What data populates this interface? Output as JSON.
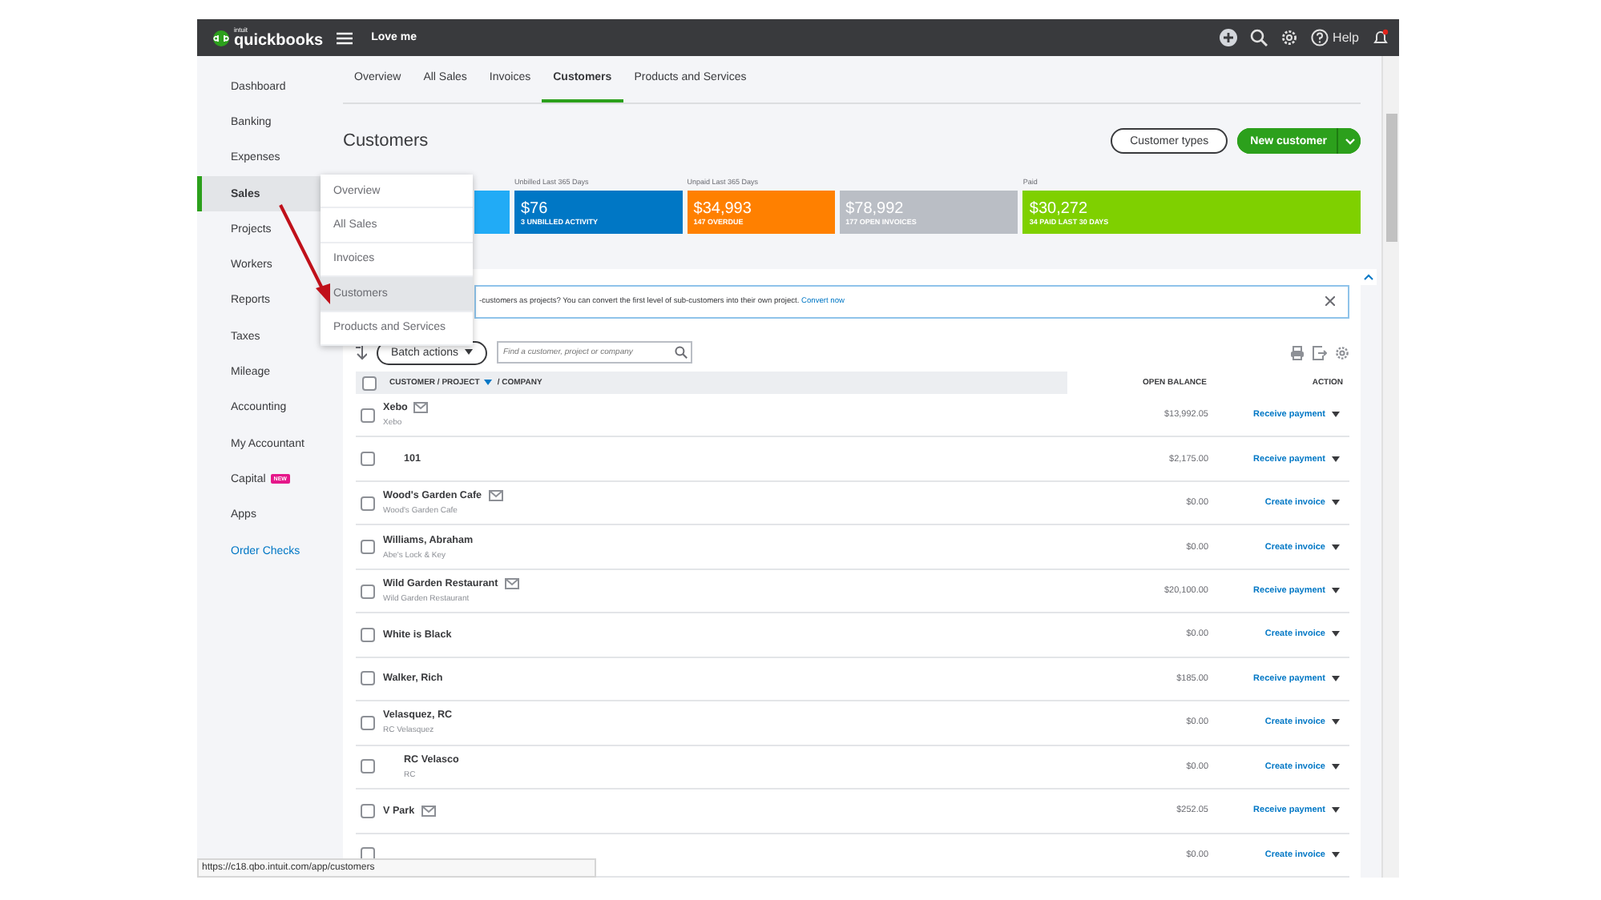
{
  "top_bar": {
    "logo_small": "intuit",
    "logo": "quickbooks",
    "company": "Love me",
    "help": "Help"
  },
  "sidebar": {
    "items": [
      {
        "label": "Dashboard",
        "selected": false,
        "kind": "nav"
      },
      {
        "label": "Banking",
        "selected": false,
        "kind": "nav"
      },
      {
        "label": "Expenses",
        "selected": false,
        "kind": "nav"
      },
      {
        "label": "Sales",
        "selected": true,
        "kind": "nav"
      },
      {
        "label": "Projects",
        "selected": false,
        "kind": "nav"
      },
      {
        "label": "Workers",
        "selected": false,
        "kind": "nav"
      },
      {
        "label": "Reports",
        "selected": false,
        "kind": "nav"
      },
      {
        "label": "Taxes",
        "selected": false,
        "kind": "nav"
      },
      {
        "label": "Mileage",
        "selected": false,
        "kind": "nav"
      },
      {
        "label": "Accounting",
        "selected": false,
        "kind": "nav"
      },
      {
        "label": "My Accountant",
        "selected": false,
        "kind": "nav"
      },
      {
        "label": "Capital",
        "selected": false,
        "kind": "nav",
        "badge": "NEW"
      },
      {
        "label": "Apps",
        "selected": false,
        "kind": "nav"
      },
      {
        "label": "Order Checks",
        "selected": false,
        "kind": "link"
      }
    ]
  },
  "flyout": {
    "items": [
      {
        "label": "Overview",
        "selected": false
      },
      {
        "label": "All Sales",
        "selected": false
      },
      {
        "label": "Invoices",
        "selected": false
      },
      {
        "label": "Customers",
        "selected": true
      },
      {
        "label": "Products and Services",
        "selected": false
      }
    ]
  },
  "tabs": [
    {
      "label": "Overview",
      "selected": false
    },
    {
      "label": "All Sales",
      "selected": false
    },
    {
      "label": "Invoices",
      "selected": false
    },
    {
      "label": "Customers",
      "selected": true
    },
    {
      "label": "Products and Services",
      "selected": false
    }
  ],
  "title": "Customers",
  "buttons": {
    "secondary": "Customer types",
    "primary": "New customer"
  },
  "money_bar": [
    {
      "color": "#21abf6"
    },
    {
      "label": "Unbilled Last 365 Days",
      "amount": "$76",
      "caption": "3 UNBILLED ACTIVITY",
      "color": "#0077c5"
    },
    {
      "label": "Unpaid Last 365 Days",
      "amount": "$34,993",
      "caption": "147 OVERDUE",
      "color": "#ff8000"
    },
    {
      "amount": "$78,992",
      "caption": "177 OPEN INVOICES",
      "color": "#babec5"
    },
    {
      "label": "Paid",
      "amount": "$30,272",
      "caption": "34 PAID LAST 30 DAYS",
      "color": "#7fd000"
    }
  ],
  "banner": {
    "text": "-customers as projects? You can convert the first level of sub-customers into their own project.",
    "link": "Convert now"
  },
  "toolbar": {
    "batch": "Batch actions",
    "search_placeholder": "Find a customer, project or company"
  },
  "table": {
    "columns": [
      "CUSTOMER / PROJECT",
      "/ COMPANY",
      "OPEN BALANCE",
      "ACTION"
    ],
    "header_checked": false,
    "rows": [
      {
        "name": "Xebo",
        "company": "Xebo",
        "email": true,
        "checked": false,
        "balance": "$13,992.05",
        "action": "Receive payment",
        "children": [
          {
            "name": "101",
            "email": false,
            "checked": false,
            "balance": "$2,175.00",
            "action": "Receive payment"
          }
        ]
      },
      {
        "name": "Wood's Garden Cafe",
        "company": "Wood's Garden Cafe",
        "email": true,
        "checked": false,
        "balance": "$0.00",
        "action": "Create invoice"
      },
      {
        "name": "Williams, Abraham",
        "company": "Abe's Lock & Key",
        "email": false,
        "checked": false,
        "balance": "$0.00",
        "action": "Create invoice"
      },
      {
        "name": "Wild Garden Restaurant",
        "company": "Wild Garden Restaurant",
        "email": true,
        "checked": false,
        "balance": "$20,100.00",
        "action": "Receive payment"
      },
      {
        "name": "White is Black",
        "email": false,
        "checked": false,
        "balance": "$0.00",
        "action": "Create invoice"
      },
      {
        "name": "Walker, Rich",
        "email": false,
        "checked": false,
        "balance": "$185.00",
        "action": "Receive payment"
      },
      {
        "name": "Velasquez, RC",
        "company": "RC Velasquez",
        "email": false,
        "checked": false,
        "balance": "$0.00",
        "action": "Create invoice",
        "children": [
          {
            "name": "RC Velasco",
            "company": "RC",
            "email": false,
            "checked": false,
            "balance": "$0.00",
            "action": "Create invoice"
          }
        ]
      },
      {
        "name": "V Park",
        "email": true,
        "checked": false,
        "balance": "$252.05",
        "action": "Receive payment"
      },
      {
        "email": false,
        "checked": false,
        "balance": "$0.00",
        "action": "Create invoice"
      }
    ]
  },
  "status_url": "https://c18.qbo.intuit.com/app/customers"
}
